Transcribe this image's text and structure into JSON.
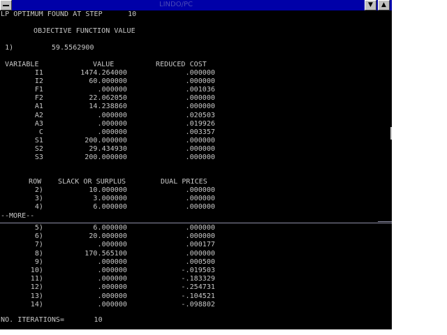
{
  "window": {
    "title": "LINDO/PC",
    "minimize_glyph": "▼",
    "maximize_glyph": "▲"
  },
  "output": {
    "optimum_line": "LP OPTIMUM FOUND AT STEP      10",
    "objective_heading": "OBJECTIVE FUNCTION VALUE",
    "objective_row": " 1)         59.5562900",
    "variable_header": {
      "name": "VARIABLE",
      "value": "VALUE",
      "reduced_cost": "REDUCED COST"
    },
    "variables": [
      {
        "name": "I1",
        "value": "1474.264000",
        "reduced_cost": ".000000"
      },
      {
        "name": "I2",
        "value": "60.000000",
        "reduced_cost": ".000000"
      },
      {
        "name": "F1",
        "value": ".000000",
        "reduced_cost": ".001036"
      },
      {
        "name": "F2",
        "value": "22.062050",
        "reduced_cost": ".000000"
      },
      {
        "name": "A1",
        "value": "14.238860",
        "reduced_cost": ".000000"
      },
      {
        "name": "A2",
        "value": ".000000",
        "reduced_cost": ".020503"
      },
      {
        "name": "A3",
        "value": ".000000",
        "reduced_cost": ".019926"
      },
      {
        "name": "C",
        "value": ".000000",
        "reduced_cost": ".003357"
      },
      {
        "name": "S1",
        "value": "200.000000",
        "reduced_cost": ".000000"
      },
      {
        "name": "S2",
        "value": "29.434930",
        "reduced_cost": ".000000"
      },
      {
        "name": "S3",
        "value": "200.000000",
        "reduced_cost": ".000000"
      }
    ],
    "row_header": {
      "row": "ROW",
      "slack": "SLACK OR SURPLUS",
      "dual": "DUAL PRICES"
    },
    "rows_page1": [
      {
        "row": "2)",
        "slack": "10.000000",
        "dual": ".000000"
      },
      {
        "row": "3)",
        "slack": "3.000000",
        "dual": ".000000"
      },
      {
        "row": "4)",
        "slack": "6.000000",
        "dual": ".000000"
      }
    ],
    "more_prompt": "--MORE--",
    "rows_page2": [
      {
        "row": "5)",
        "slack": "6.000000",
        "dual": ".000000"
      },
      {
        "row": "6)",
        "slack": "20.000000",
        "dual": ".000000"
      },
      {
        "row": "7)",
        "slack": ".000000",
        "dual": ".000177"
      },
      {
        "row": "8)",
        "slack": "170.565100",
        "dual": ".000000"
      },
      {
        "row": "9)",
        "slack": ".000000",
        "dual": ".000500"
      },
      {
        "row": "10)",
        "slack": ".000000",
        "dual": "-.019503"
      },
      {
        "row": "11)",
        "slack": ".000000",
        "dual": "-.183329"
      },
      {
        "row": "12)",
        "slack": ".000000",
        "dual": "-.254731"
      },
      {
        "row": "13)",
        "slack": ".000000",
        "dual": "-.104521"
      },
      {
        "row": "14)",
        "slack": ".000000",
        "dual": "-.098802"
      }
    ],
    "iterations_line": "NO. ITERATIONS=       10"
  }
}
